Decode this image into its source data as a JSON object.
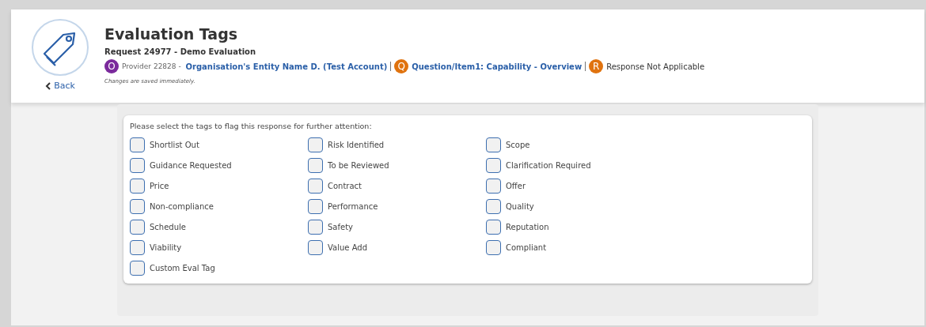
{
  "header": {
    "title": "Evaluation Tags",
    "subtitle": "Request 24977 - Demo Evaluation",
    "back": "Back",
    "note": "Changes are saved immediately.",
    "crumbs": [
      {
        "badge": "O",
        "color": "#7b2a9c",
        "prefix": "Provider 22828 - ",
        "text": "Organisation's Entity Name D. (Test Account)",
        "kind": "link"
      },
      {
        "badge": "Q",
        "color": "#e0730f",
        "text": "Question/Item1: Capability - Overview",
        "kind": "link"
      },
      {
        "badge": "R",
        "color": "#e0730f",
        "text": "Response Not Applicable",
        "kind": "plain"
      }
    ]
  },
  "prompt": "Please select the tags to flag this response for further attention:",
  "tags": [
    {
      "label": "Shortlist Out",
      "checked": false
    },
    {
      "label": "Risk Identified",
      "checked": false
    },
    {
      "label": "Scope",
      "checked": false
    },
    {
      "label": "Guidance Requested",
      "checked": false
    },
    {
      "label": "To be Reviewed",
      "checked": false
    },
    {
      "label": "Clarification Required",
      "checked": false
    },
    {
      "label": "Price",
      "checked": false
    },
    {
      "label": "Contract",
      "checked": false
    },
    {
      "label": "Offer",
      "checked": false
    },
    {
      "label": "Non-compliance",
      "checked": false
    },
    {
      "label": "Performance",
      "checked": false
    },
    {
      "label": "Quality",
      "checked": false
    },
    {
      "label": "Schedule",
      "checked": false
    },
    {
      "label": "Safety",
      "checked": false
    },
    {
      "label": "Reputation",
      "checked": false
    },
    {
      "label": "Viability",
      "checked": false
    },
    {
      "label": "Value Add",
      "checked": false
    },
    {
      "label": "Compliant",
      "checked": false
    },
    {
      "label": "Custom Eval Tag",
      "checked": false
    }
  ]
}
